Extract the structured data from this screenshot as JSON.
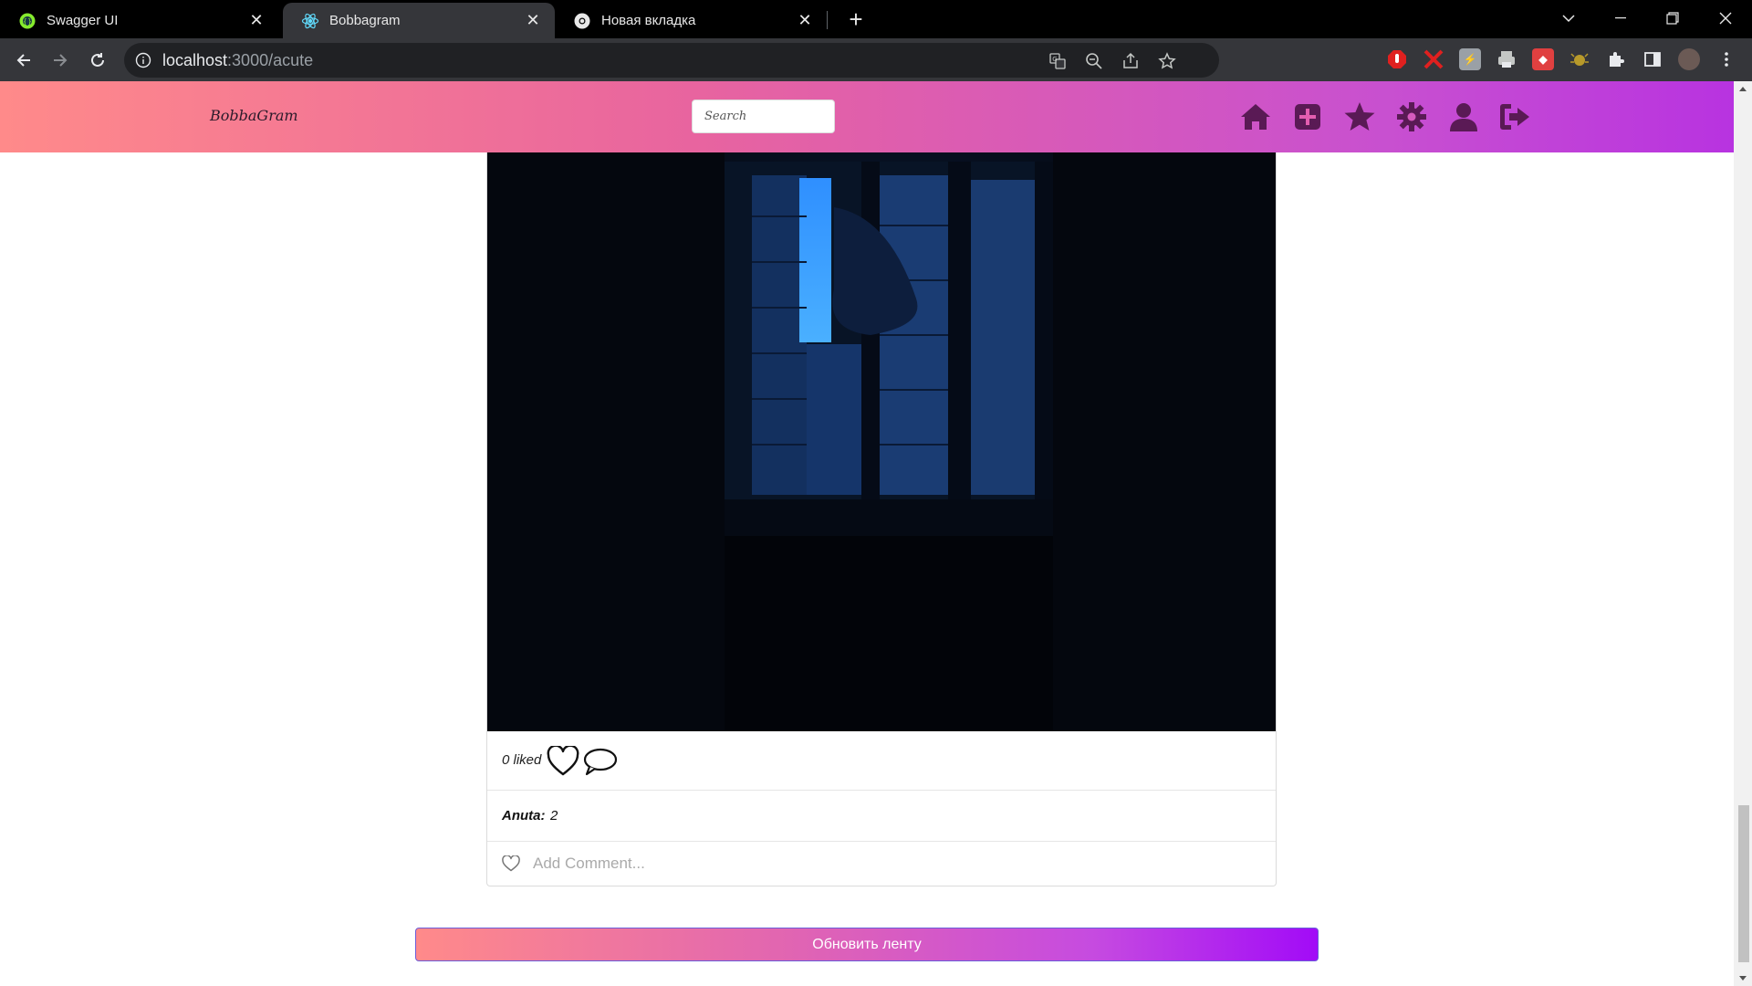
{
  "browser": {
    "tabs": [
      {
        "title": "Swagger UI",
        "icon": "swagger-icon"
      },
      {
        "title": "Bobbagram",
        "icon": "react-icon"
      },
      {
        "title": "Новая вкладка",
        "icon": "chrome-icon"
      }
    ],
    "active_tab": 1,
    "url": {
      "host": "localhost",
      "path": ":3000/acute"
    }
  },
  "app": {
    "logo": "BobbaGram",
    "search_placeholder": "Search",
    "nav_icons": [
      "home-icon",
      "add-post-icon",
      "star-icon",
      "settings-icon",
      "profile-icon",
      "logout-icon"
    ],
    "gradient": {
      "start": "#ff8a8a",
      "mid": "#e8649f",
      "end": "#b833e0"
    }
  },
  "post": {
    "likes_text": "0 liked",
    "author": "Anuta:",
    "caption": "2",
    "comment_placeholder": "Add Comment..."
  },
  "refresh_button": "Обновить ленту"
}
